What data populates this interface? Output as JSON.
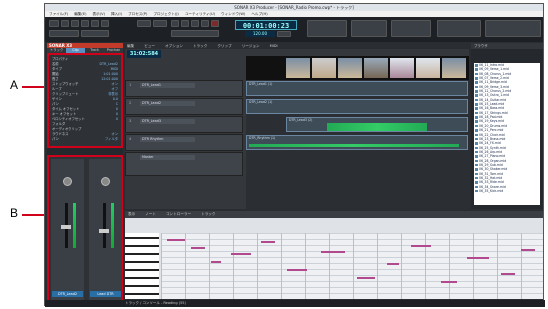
{
  "annotations": {
    "a": "A",
    "b": "B"
  },
  "window": {
    "title": "SONAR X3 Producer - [SONAR_Radio Promo.cwp* - トラック]"
  },
  "menu": [
    "ファイル(F)",
    "編集(E)",
    "表示(V)",
    "挿入(I)",
    "プロセス(P)",
    "プロジェクト(J)",
    "ユーティリティ(U)",
    "ウィンドウ(W)",
    "ヘルプ(H)"
  ],
  "transport": {
    "time": "00:01:00:23",
    "tempo": "120.00",
    "meter": "4/4"
  },
  "inspector": {
    "header": "SONAR X3",
    "tabs": [
      "トラック",
      "Clip",
      "Track",
      "Prochan"
    ],
    "active_tab": "Clip",
    "props": [
      {
        "k": "プロパティ",
        "v": ""
      },
      {
        "k": "名前",
        "v": "DTR_Lead2"
      },
      {
        "k": "タイプ",
        "v": "MIDI"
      },
      {
        "k": "開始",
        "v": "1:01:000"
      },
      {
        "k": "長さ",
        "v": "12:01:000"
      },
      {
        "k": "ストップウォッチ",
        "v": "オン"
      },
      {
        "k": "ループ",
        "v": "オフ"
      },
      {
        "k": "クリップミュート",
        "v": "非表示"
      },
      {
        "k": "ゲイン",
        "v": "0.0"
      },
      {
        "k": "パン",
        "v": "C"
      },
      {
        "k": "タイム オフセット",
        "v": "0"
      },
      {
        "k": "キー オフセット",
        "v": "0"
      },
      {
        "k": "ベロシティオフセット",
        "v": "0"
      },
      {
        "k": "フォルダ",
        "v": ""
      },
      {
        "k": "オーディオクリップ",
        "v": ""
      },
      {
        "k": "ラウドネス",
        "v": "オン"
      },
      {
        "k": "パン",
        "v": "フィルタ"
      }
    ],
    "strips": [
      {
        "name": "DTR_Lead2"
      },
      {
        "name": "Lead DTR"
      }
    ]
  },
  "trackview": {
    "menu": [
      "編集",
      "ビュー",
      "オプション",
      "トラック",
      "クリップ",
      "リージョン",
      "MIDI"
    ],
    "now": "31:02:584",
    "tracks": [
      {
        "num": "1",
        "name": "DTR_Lead1"
      },
      {
        "num": "2",
        "name": "DTR_Lead2"
      },
      {
        "num": "3",
        "name": "DTR_Lead3"
      },
      {
        "num": "4",
        "name": "DTR Rhythm"
      },
      {
        "num": "",
        "name": "Master"
      }
    ],
    "clips": [
      {
        "label": "DTR_Lead1 (1)"
      },
      {
        "label": "DTR_Lead2 (1)"
      },
      {
        "label": "DTR_Lead3 (2)"
      },
      {
        "label": "DTR_Rhythm (1)"
      }
    ]
  },
  "browser": {
    "tab": "ブラウザ",
    "files": [
      "06_11_Intro.mid",
      "06_09_Verse_1.mid",
      "06_08_Chorus_1.mid",
      "06_07_Verse_2.mid",
      "06_11_Bridge.mid",
      "06_09_Verse_3.mid",
      "06_12_Chorus_2.mid",
      "06_13_Outro_1.mid",
      "06_14_Guitar.mid",
      "06_15_Lead.mid",
      "06_16_Bass.mid",
      "06_17_Strings.mid",
      "06_18_Pad.mid",
      "06_19_Keys.mid",
      "06_20_Drums.mid",
      "06_21_Perc.mid",
      "06_22_Choir.mid",
      "06_23_Brass.mid",
      "06_24_FX.mid",
      "06_25_Synth.mid",
      "06_26_Arp.mid",
      "06_27_Piano.mid",
      "06_28_Organ.mid",
      "06_29_Sub.mid",
      "06_30_Shaker.mid",
      "06_31_Tom.mid",
      "06_32_Hat.mid",
      "06_33_Ride.mid",
      "06_34_Snare.mid",
      "06_35_Kick.mid"
    ]
  },
  "pianoroll": {
    "menu": [
      "表示",
      "ノート",
      "コントローラー",
      "トラック"
    ]
  },
  "status": {
    "text": "トラック / コンソール - Reading (55)"
  }
}
